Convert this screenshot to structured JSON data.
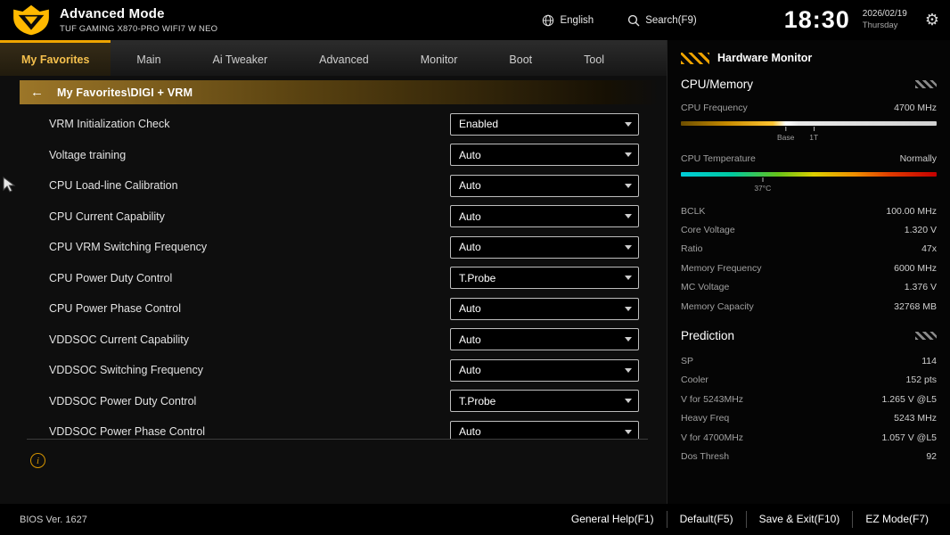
{
  "accent_color": "#efa400",
  "header": {
    "title": "Advanced Mode",
    "subtitle": "TUF GAMING X870-PRO WIFI7 W NEO",
    "language": "English",
    "search_label": "Search(F9)",
    "time": "18:30",
    "date": "2026/02/19",
    "day": "Thursday"
  },
  "tabs": [
    {
      "label": "My Favorites",
      "active": true
    },
    {
      "label": "Main",
      "active": false
    },
    {
      "label": "Ai Tweaker",
      "active": false
    },
    {
      "label": "Advanced",
      "active": false
    },
    {
      "label": "Monitor",
      "active": false
    },
    {
      "label": "Boot",
      "active": false
    },
    {
      "label": "Tool",
      "active": false
    }
  ],
  "breadcrumb": "My Favorites\\DIGI + VRM",
  "settings": [
    {
      "label": "VRM Initialization Check",
      "value": "Enabled"
    },
    {
      "label": "Voltage training",
      "value": "Auto"
    },
    {
      "label": "CPU Load-line Calibration",
      "value": "Auto"
    },
    {
      "label": "CPU Current Capability",
      "value": "Auto"
    },
    {
      "label": "CPU VRM Switching Frequency",
      "value": "Auto"
    },
    {
      "label": "CPU Power Duty Control",
      "value": "T.Probe"
    },
    {
      "label": "CPU Power Phase Control",
      "value": "Auto"
    },
    {
      "label": "VDDSOC Current Capability",
      "value": "Auto"
    },
    {
      "label": "VDDSOC Switching Frequency",
      "value": "Auto"
    },
    {
      "label": "VDDSOC Power Duty Control",
      "value": "T.Probe"
    },
    {
      "label": "VDDSOC Power Phase Control",
      "value": "Auto"
    }
  ],
  "monitor": {
    "title": "Hardware Monitor",
    "cpu_memory": {
      "title": "CPU/Memory",
      "frequency_label": "CPU Frequency",
      "frequency_value": "4700 MHz",
      "frequency_markers": [
        {
          "label": "Base",
          "pos": 41
        },
        {
          "label": "1T",
          "pos": 52
        }
      ],
      "temperature_label": "CPU Temperature",
      "temperature_value": "Normally",
      "temperature_marker": {
        "label": "37°C",
        "pos": 32
      },
      "stats": [
        {
          "label": "BCLK",
          "value": "100.00 MHz"
        },
        {
          "label": "Core Voltage",
          "value": "1.320 V"
        },
        {
          "label": "Ratio",
          "value": "47x"
        },
        {
          "label": "Memory Frequency",
          "value": "6000 MHz"
        },
        {
          "label": "MC Voltage",
          "value": "1.376 V"
        },
        {
          "label": "Memory Capacity",
          "value": "32768 MB"
        }
      ]
    },
    "prediction": {
      "title": "Prediction",
      "stats": [
        {
          "label": "SP",
          "value": "114"
        },
        {
          "label": "Cooler",
          "value": "152 pts"
        },
        {
          "label": "V for 5243MHz",
          "value": "1.265 V @L5"
        },
        {
          "label": "Heavy Freq",
          "value": "5243 MHz"
        },
        {
          "label": "V for 4700MHz",
          "value": "1.057 V @L5"
        },
        {
          "label": "Dos Thresh",
          "value": "92"
        }
      ]
    }
  },
  "footer": {
    "bios_version": "BIOS Ver. 1627",
    "actions": [
      "General Help(F1)",
      "Default(F5)",
      "Save & Exit(F10)",
      "EZ Mode(F7)"
    ]
  }
}
